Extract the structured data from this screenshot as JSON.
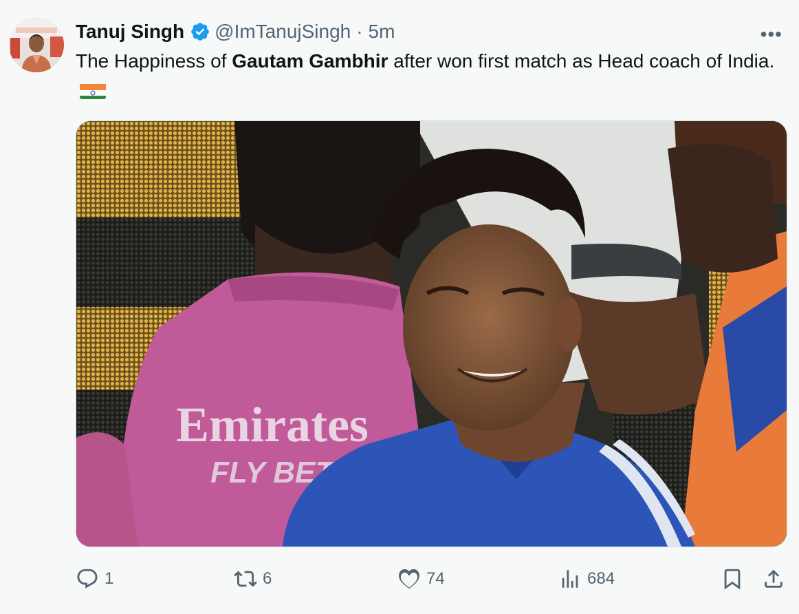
{
  "tweet": {
    "display_name": "Tanuj Singh",
    "handle": "@ImTanujSingh",
    "separator": "·",
    "time": "5m",
    "more_label": "•••",
    "text_before": "The Happiness of ",
    "text_bold": "Gautam Gambhir",
    "text_after": " after won first match as Head coach of India.",
    "media_text": {
      "sponsor": "Emirates",
      "tagline": "FLY BETT"
    }
  },
  "actions": {
    "replies": "1",
    "retweets": "6",
    "likes": "74",
    "views": "684"
  },
  "colors": {
    "verified": "#1d9bf0",
    "muted": "#536471",
    "text": "#0f1419",
    "background": "#f7f9f9"
  },
  "icons": [
    "verified-badge-icon",
    "more-icon",
    "reply-icon",
    "retweet-icon",
    "like-icon",
    "views-icon",
    "bookmark-icon",
    "share-icon",
    "india-flag-icon"
  ]
}
